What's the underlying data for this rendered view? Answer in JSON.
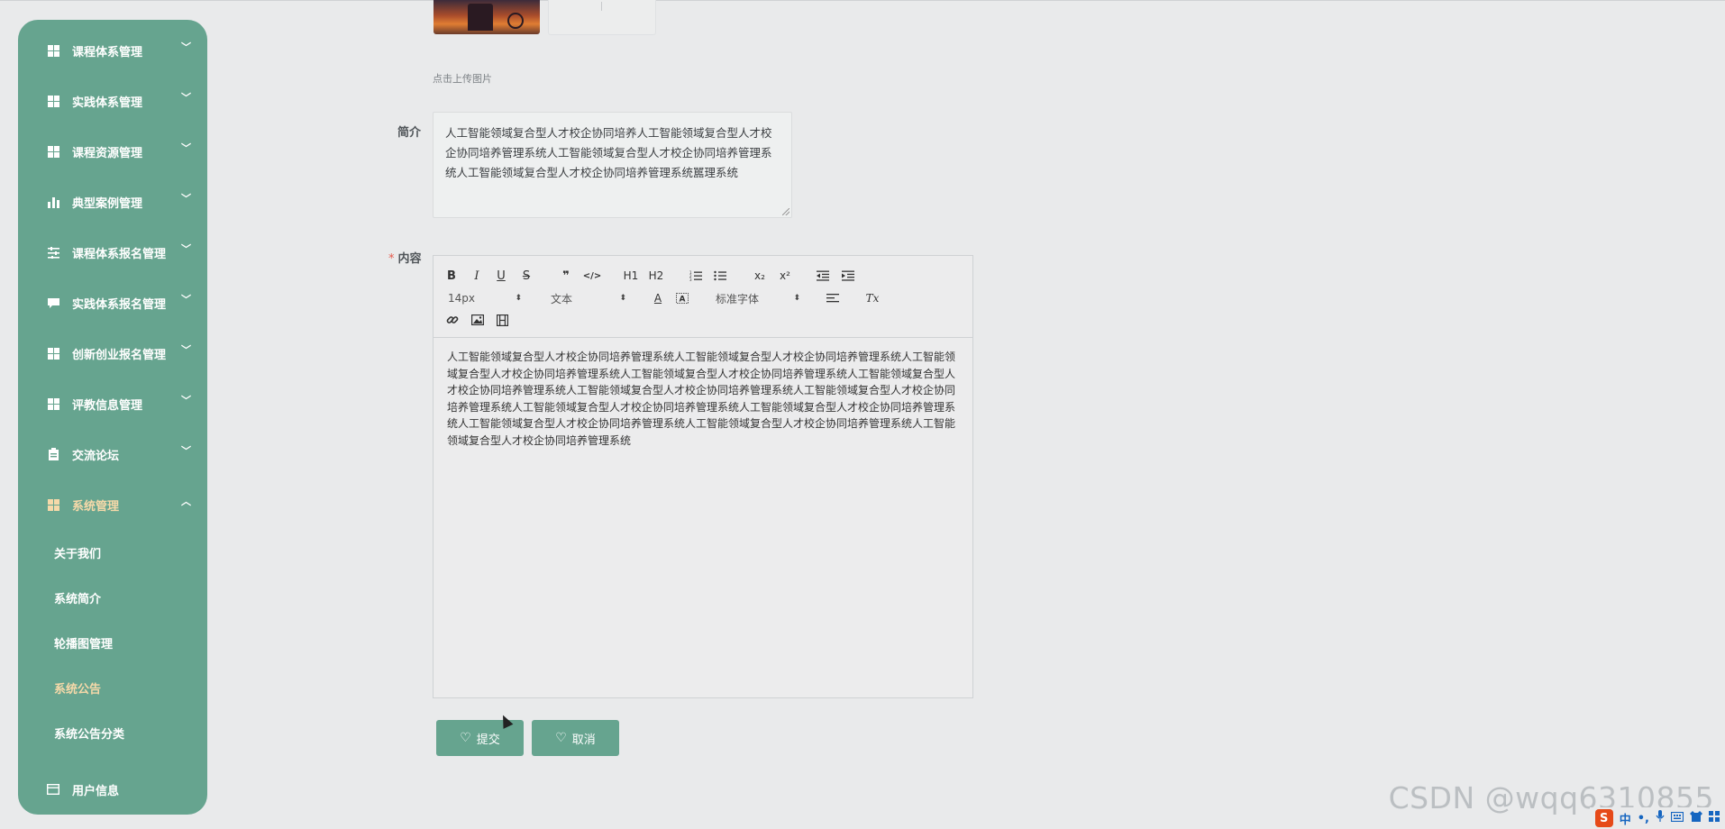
{
  "sidebar": {
    "menus": [
      {
        "label": "课程体系管理",
        "icon": "grid-icon"
      },
      {
        "label": "实践体系管理",
        "icon": "grid-icon"
      },
      {
        "label": "课程资源管理",
        "icon": "grid-icon"
      },
      {
        "label": "典型案例管理",
        "icon": "bar-chart-icon"
      },
      {
        "label": "课程体系报名管理",
        "icon": "sliders-icon"
      },
      {
        "label": "实践体系报名管理",
        "icon": "comment-icon"
      },
      {
        "label": "创新创业报名管理",
        "icon": "grid-icon"
      },
      {
        "label": "评教信息管理",
        "icon": "grid-icon"
      },
      {
        "label": "交流论坛",
        "icon": "clipboard-icon"
      },
      {
        "label": "系统管理",
        "icon": "grid-icon",
        "expanded": true
      }
    ],
    "submenu": [
      {
        "label": "关于我们"
      },
      {
        "label": "系统简介"
      },
      {
        "label": "轮播图管理"
      },
      {
        "label": "系统公告",
        "selected": true
      },
      {
        "label": "系统公告分类"
      }
    ],
    "user_menu": {
      "label": "用户信息",
      "icon": "card-icon"
    }
  },
  "form": {
    "upload_hint": "点击上传图片",
    "intro_label": "简介",
    "intro_text": "人工智能领域复合型人才校企协同培养人工智能领域复合型人才校企协同培养管理系统人工智能领域复合型人才校企协同培养管理系统人工智能领域复合型人才校企协同培养管理系统嚚理系统",
    "content_label": "内容",
    "content_required_mark": "*",
    "content_text": "人工智能领域复合型人才校企协同培养管理系统人工智能领域复合型人才校企协同培养管理系统人工智能领域复合型人才校企协同培养管理系统人工智能领域复合型人才校企协同培养管理系统人工智能领域复合型人才校企协同培养管理系统人工智能领域复合型人才校企协同培养管理系统人工智能领域复合型人才校企协同培养管理系统人工智能领域复合型人才校企协同培养管理系统人工智能领域复合型人才校企协同培养管理系统人工智能领域复合型人才校企协同培养管理系统人工智能领域复合型人才校企协同培养管理系统人工智能领域复合型人才校企协同培养管理系统"
  },
  "editor": {
    "font_size": "14px",
    "header_select": "文本",
    "font_family": "标准字体",
    "buttons": {
      "bold": "B",
      "italic": "I",
      "underline": "U",
      "strike": "S",
      "quote": "❞",
      "code": "</>",
      "h1": "H1",
      "h2": "H2",
      "subscript": "x₂",
      "superscript": "x²",
      "clean": "Tx",
      "color": "A"
    }
  },
  "actions": {
    "submit_label": "提交",
    "cancel_label": "取消"
  },
  "watermark": "CSDN @wqq6310855",
  "ime": {
    "logo": "S",
    "lang": "中",
    "punct": "•,"
  },
  "colors": {
    "sidebar_bg": "#66a48f",
    "accent_active": "#f6d9a9",
    "button_bg": "#66a48f",
    "required": "#e55b4d"
  }
}
